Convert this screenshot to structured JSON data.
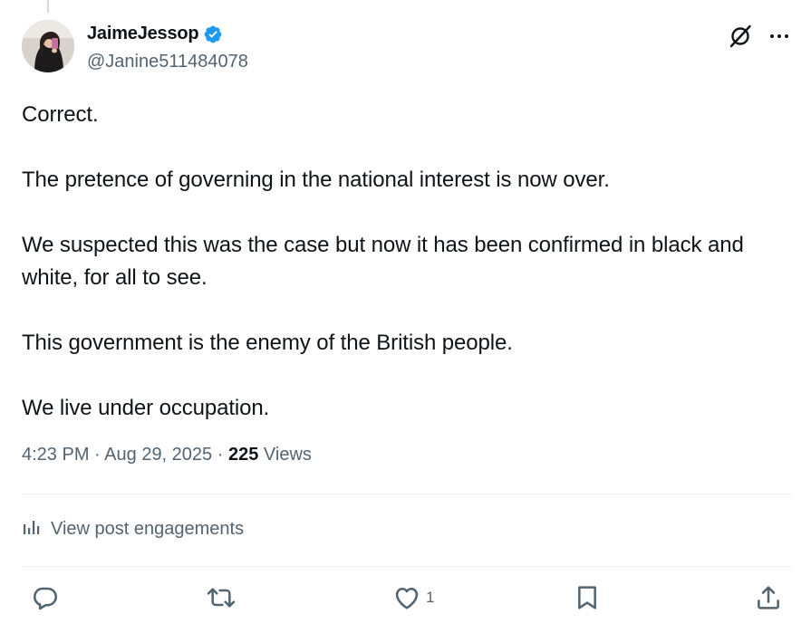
{
  "author": {
    "display_name": "JaimeJessop",
    "handle": "@Janine511484078",
    "verified": true,
    "verified_color": "#1d9bf0"
  },
  "header_actions": {
    "grok_icon": "grok-icon",
    "more_icon": "more-icon"
  },
  "tweet": {
    "paragraphs": [
      "Correct.",
      "The pretence of governing in the national interest is now over.",
      "We suspected this was the case but now it has been confirmed in black and white, for all to see.",
      "This government is the enemy of the British people.",
      "We live under occupation."
    ]
  },
  "meta": {
    "time": "4:23 PM",
    "separator": "·",
    "date": "Aug 29, 2025",
    "views_count": "225",
    "views_label": "Views"
  },
  "engagements": {
    "label": "View post engagements",
    "icon": "analytics-icon"
  },
  "actions": {
    "reply": {
      "icon": "reply-icon",
      "count": ""
    },
    "repost": {
      "icon": "repost-icon",
      "count": ""
    },
    "like": {
      "icon": "like-icon",
      "count": "1"
    },
    "bookmark": {
      "icon": "bookmark-icon",
      "count": ""
    },
    "share": {
      "icon": "share-icon",
      "count": ""
    }
  },
  "colors": {
    "text_primary": "#0f1419",
    "text_secondary": "#536471",
    "divider": "#eff3f4",
    "accent": "#1d9bf0"
  }
}
